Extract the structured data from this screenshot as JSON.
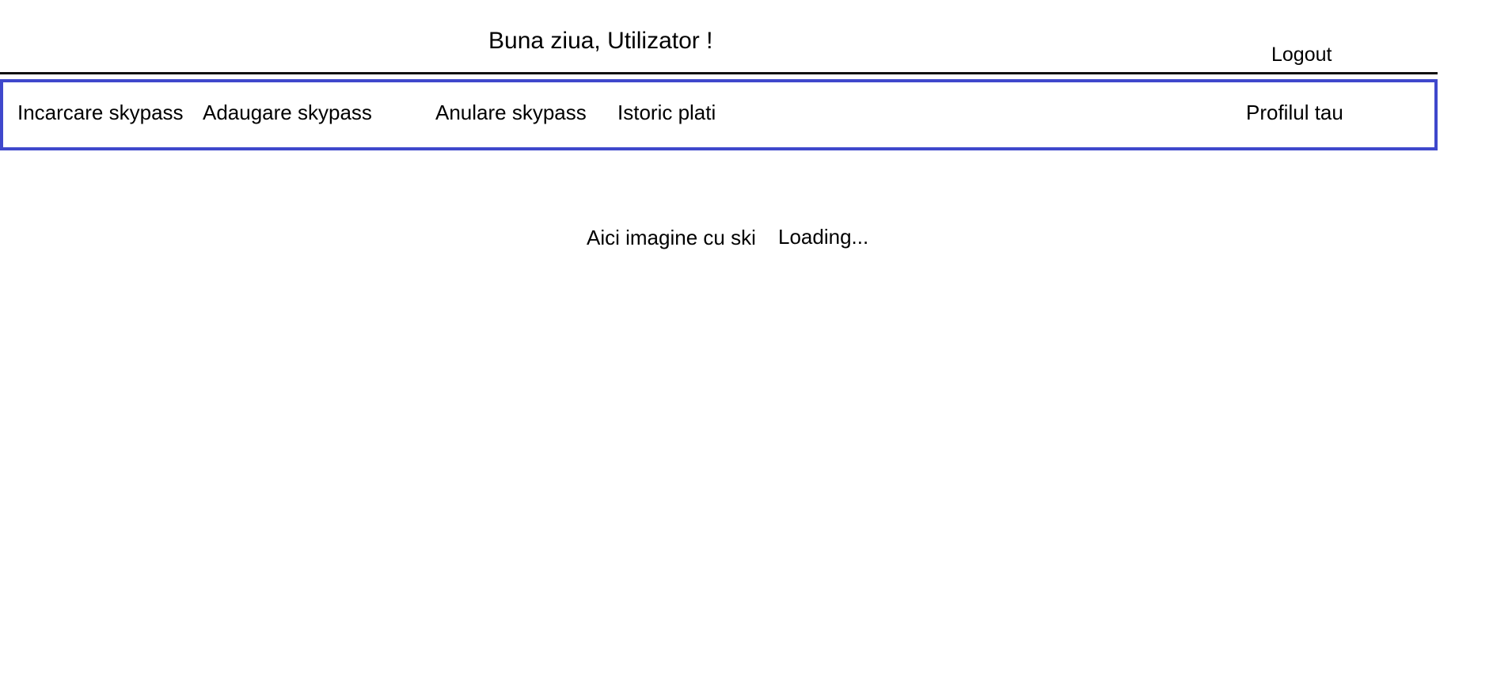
{
  "header": {
    "greeting": "Buna ziua, Utilizator !",
    "logout_label": "Logout"
  },
  "nav": {
    "items": [
      {
        "label": "Incarcare skypass"
      },
      {
        "label": "Adaugare skypass"
      },
      {
        "label": "Anulare skypass"
      },
      {
        "label": "Istoric plati"
      },
      {
        "label": "Profilul tau"
      }
    ]
  },
  "main": {
    "image_placeholder": "Aici imagine cu ski",
    "loading_text": "Loading..."
  },
  "colors": {
    "nav_border": "#3f48cc",
    "header_rule": "#111111",
    "background": "#ffffff"
  }
}
